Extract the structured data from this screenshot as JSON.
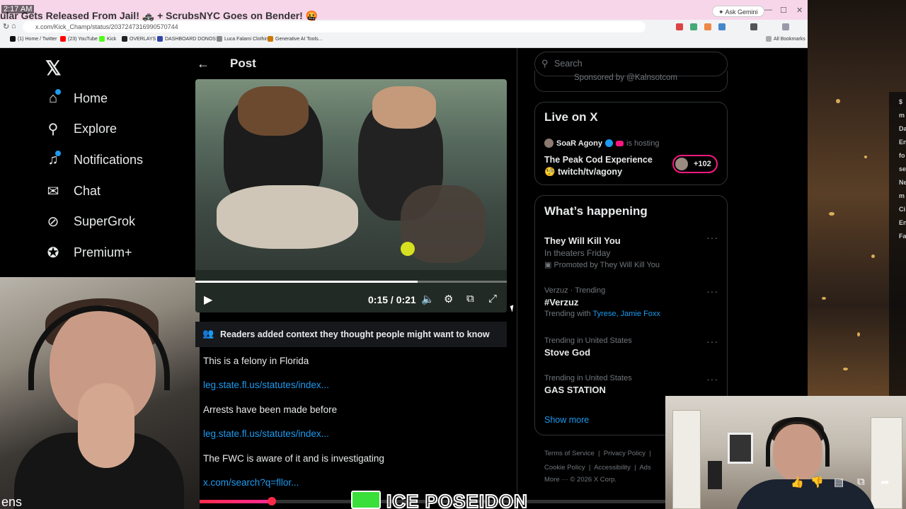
{
  "browser": {
    "clock": "2:17 AM",
    "tab_title": "ular Gets Released From Jail! 🚓 + ScrubsNYC Goes on Bender! 🤬",
    "ask_gemini": "✦ Ask Gemini",
    "url": "x.com/Kick_Champ/status/2037247316990570744",
    "bookmarks": [
      {
        "label": "(1) Home / Twitter",
        "color": "#111111"
      },
      {
        "label": "(23) YouTube",
        "color": "#ff0000"
      },
      {
        "label": "Kick",
        "color": "#53fc18"
      },
      {
        "label": "OVERLAYS",
        "color": "#222222"
      },
      {
        "label": "DASHBOARD DONOS",
        "color": "#3344aa"
      },
      {
        "label": "Luca Falami Clothing",
        "color": "#888888"
      },
      {
        "label": "Generative AI Tools...",
        "color": "#cc7700"
      }
    ],
    "all_bookmarks": "All Bookmarks"
  },
  "nav": {
    "logo": "𝕏",
    "items": [
      {
        "label": "Home",
        "icon": "home-icon"
      },
      {
        "label": "Explore",
        "icon": "search-icon"
      },
      {
        "label": "Notifications",
        "icon": "bell-icon"
      },
      {
        "label": "Chat",
        "icon": "mail-icon"
      },
      {
        "label": "SuperGrok",
        "icon": "grok-icon"
      },
      {
        "label": "Premium+",
        "icon": "verified-icon"
      }
    ]
  },
  "post": {
    "title": "Post",
    "video": {
      "elapsed": "0:15 / 0:21",
      "progress": 0.714
    },
    "note_heading": "Readers added context they thought people might want to know",
    "note_lines": [
      {
        "type": "text",
        "value": "This is a felony in Florida"
      },
      {
        "type": "link",
        "value": "leg.state.fl.us/statutes/index..."
      },
      {
        "type": "text",
        "value": "Arrests have been made before"
      },
      {
        "type": "link",
        "value": "leg.state.fl.us/statutes/index..."
      },
      {
        "type": "text",
        "value": "The FWC is aware of it and is investigating"
      },
      {
        "type": "link",
        "value": "x.com/search?q=fllor..."
      }
    ]
  },
  "sidebar": {
    "search_placeholder": "Search",
    "sponsored": "Sponsored by @Kalnsotcom",
    "live": {
      "title": "Live on X",
      "host_name": "SoaR Agony",
      "host_suffix": "is hosting",
      "space_title_1": "The Peak Cod Experience",
      "space_title_2": "🧐 twitch/tv/agony",
      "listeners": "+102"
    },
    "happening": {
      "title": "What’s happening",
      "trends": [
        {
          "meta": "",
          "name": "They Will Kill You",
          "sub": "In theaters Friday",
          "promo": "Promoted by They Will Kill You"
        },
        {
          "meta": "Verzuz · Trending",
          "name": "#Verzuz",
          "sub_prefix": "Trending with",
          "sub_link": "Tyrese, Jamie Foxx"
        },
        {
          "meta": "Trending in United States",
          "name": "Stove God"
        },
        {
          "meta": "Trending in United States",
          "name": "GAS STATION"
        }
      ],
      "show_more": "Show more"
    },
    "footer": {
      "line1": [
        "Terms of Service",
        "Privacy Policy"
      ],
      "line2": [
        "Cookie Policy",
        "Accessibility",
        "Ads"
      ],
      "line3": "More ···   © 2026 X Corp."
    }
  },
  "overlay": {
    "corner_text": "ens",
    "banner": "ICE POSEIDON",
    "side_letters": [
      "$",
      "m",
      "Da",
      "En",
      "fo",
      "se",
      "Ne",
      "m",
      "Ci",
      "En",
      "Fa"
    ]
  }
}
